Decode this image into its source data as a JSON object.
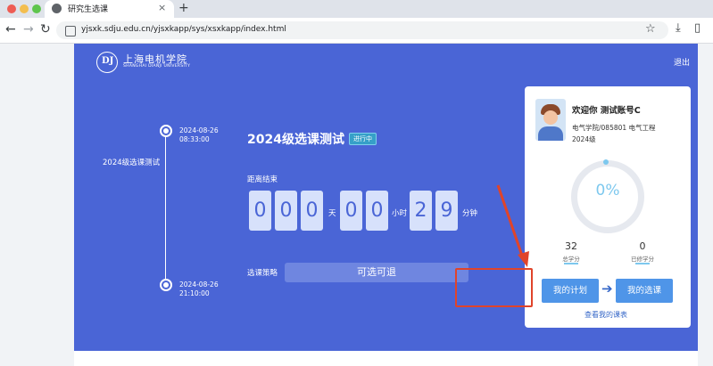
{
  "browser": {
    "tab_title": "研究生选课",
    "tab_close": "×",
    "new_tab": "+",
    "url": "yjsxk.sdju.edu.cn/yjsxkapp/sys/xsxkapp/index.html",
    "traffic_light_colors": [
      "#ee5c54",
      "#f3be4f",
      "#5ec54d"
    ]
  },
  "header": {
    "logo_cn": "上海电机学院",
    "logo_en": "SHANGHAI DIANJI UNIVERSITY",
    "logo_mark": "DJ",
    "logout": "退出"
  },
  "timeline": {
    "start_date": "2024-08-26",
    "start_time": "08:33:00",
    "label": "2024级选课测试",
    "end_date": "2024-08-26",
    "end_time": "21:10:00"
  },
  "course": {
    "title": "2024级选课测试",
    "status": "进行中",
    "countdown_label": "距离结束",
    "digits": [
      "0",
      "0",
      "0",
      "0",
      "0",
      "2",
      "9"
    ],
    "unit_day": "天",
    "unit_hour": "小时",
    "unit_minute": "分钟",
    "policy_label": "选课策略",
    "policy_value": "可选可退"
  },
  "card": {
    "welcome": "欢迎你 测试账号C",
    "dept": "电气学院/085801 电气工程",
    "grade": "2024级",
    "progress": "0%",
    "total_credits": "32",
    "total_label": "总学分",
    "earned_credits": "0",
    "earned_label": "已修学分",
    "plan_button": "我的计划",
    "courses_button": "我的选课",
    "schedule_link": "查看我的课表"
  },
  "colors": {
    "banner": "#4a65d6",
    "accent": "#4f95e8",
    "highlight": "#e0442a"
  }
}
